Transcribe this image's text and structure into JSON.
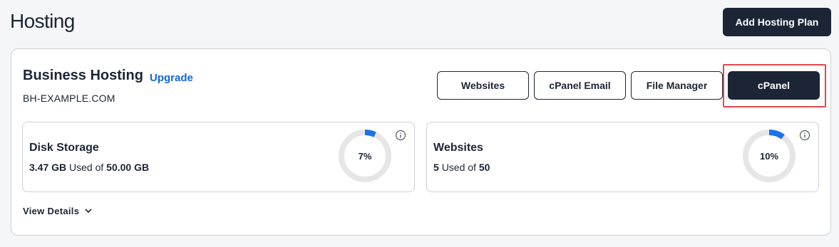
{
  "header": {
    "title": "Hosting",
    "add_button_label": "Add Hosting Plan"
  },
  "plan": {
    "name": "Business Hosting",
    "upgrade_label": "Upgrade",
    "domain": "BH-EXAMPLE.COM",
    "actions": {
      "websites": "Websites",
      "cpanel_email": "cPanel Email",
      "file_manager": "File Manager",
      "cpanel": "cPanel"
    }
  },
  "stats": {
    "disk": {
      "title": "Disk Storage",
      "used": "3.47 GB",
      "used_of": "Used of",
      "total": "50.00 GB",
      "percent_label": "7%",
      "percent_value": 7
    },
    "websites": {
      "title": "Websites",
      "used": "5",
      "used_of": "Used of",
      "total": "50",
      "percent_label": "10%",
      "percent_value": 10
    }
  },
  "footer": {
    "view_details_label": "View Details"
  },
  "colors": {
    "primary_dark": "#1c2536",
    "link_blue": "#1466d8",
    "ring_fill": "#1a73e8",
    "ring_track": "#e6e6e6",
    "highlight_red": "#e0474c"
  },
  "icons": {
    "info": "info-circle-icon",
    "chevron": "chevron-down-icon"
  }
}
